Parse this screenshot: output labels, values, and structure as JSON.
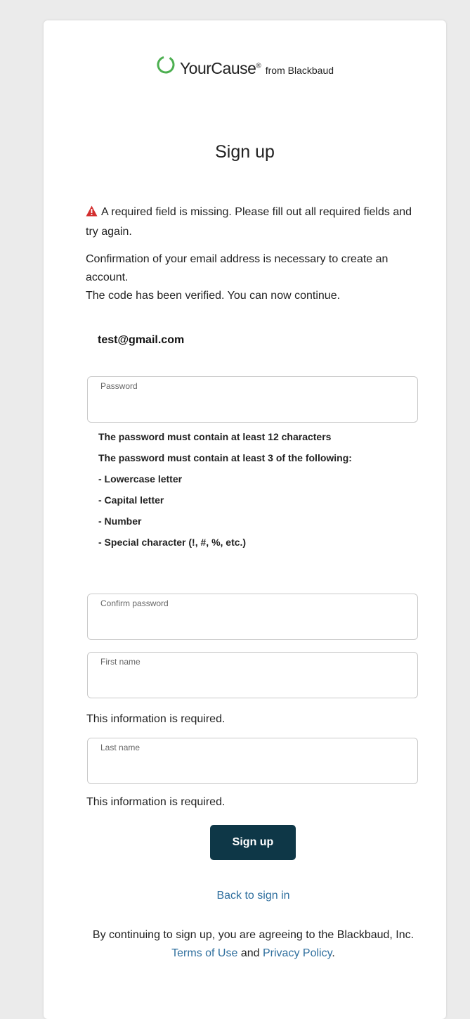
{
  "logo": {
    "brand": "YourCause",
    "registered": "®",
    "suffix": "from Blackbaud",
    "ring_color": "#4caf50"
  },
  "title": "Sign up",
  "error": {
    "icon": "warning-icon",
    "icon_color": "#d32f2f",
    "text": "A required field is missing. Please fill out all required fields and try again."
  },
  "info": {
    "line1": "Confirmation of your email address is necessary to create an account.",
    "line2": "The code has been verified. You can now continue."
  },
  "email": "test@gmail.com",
  "fields": {
    "password": {
      "label": "Password",
      "value": ""
    },
    "confirm_password": {
      "label": "Confirm password",
      "value": ""
    },
    "first_name": {
      "label": "First name",
      "value": ""
    },
    "last_name": {
      "label": "Last name",
      "value": ""
    }
  },
  "password_rules": [
    "The password must contain at least 12 characters",
    "The password must contain at least 3 of the following:",
    "- Lowercase letter",
    "- Capital letter",
    "- Number",
    "- Special character (!, #, %, etc.)"
  ],
  "required_message": "This information is required.",
  "signup_button": "Sign up",
  "back_link": "Back to sign in",
  "legal": {
    "prefix": "By continuing to sign up, you are agreeing to the Blackbaud, Inc.",
    "terms": "Terms of Use",
    "and": "and",
    "privacy": "Privacy Policy",
    "period": "."
  },
  "colors": {
    "button": "#0e3747",
    "link": "#2f6f9e",
    "background": "#ebebeb"
  }
}
